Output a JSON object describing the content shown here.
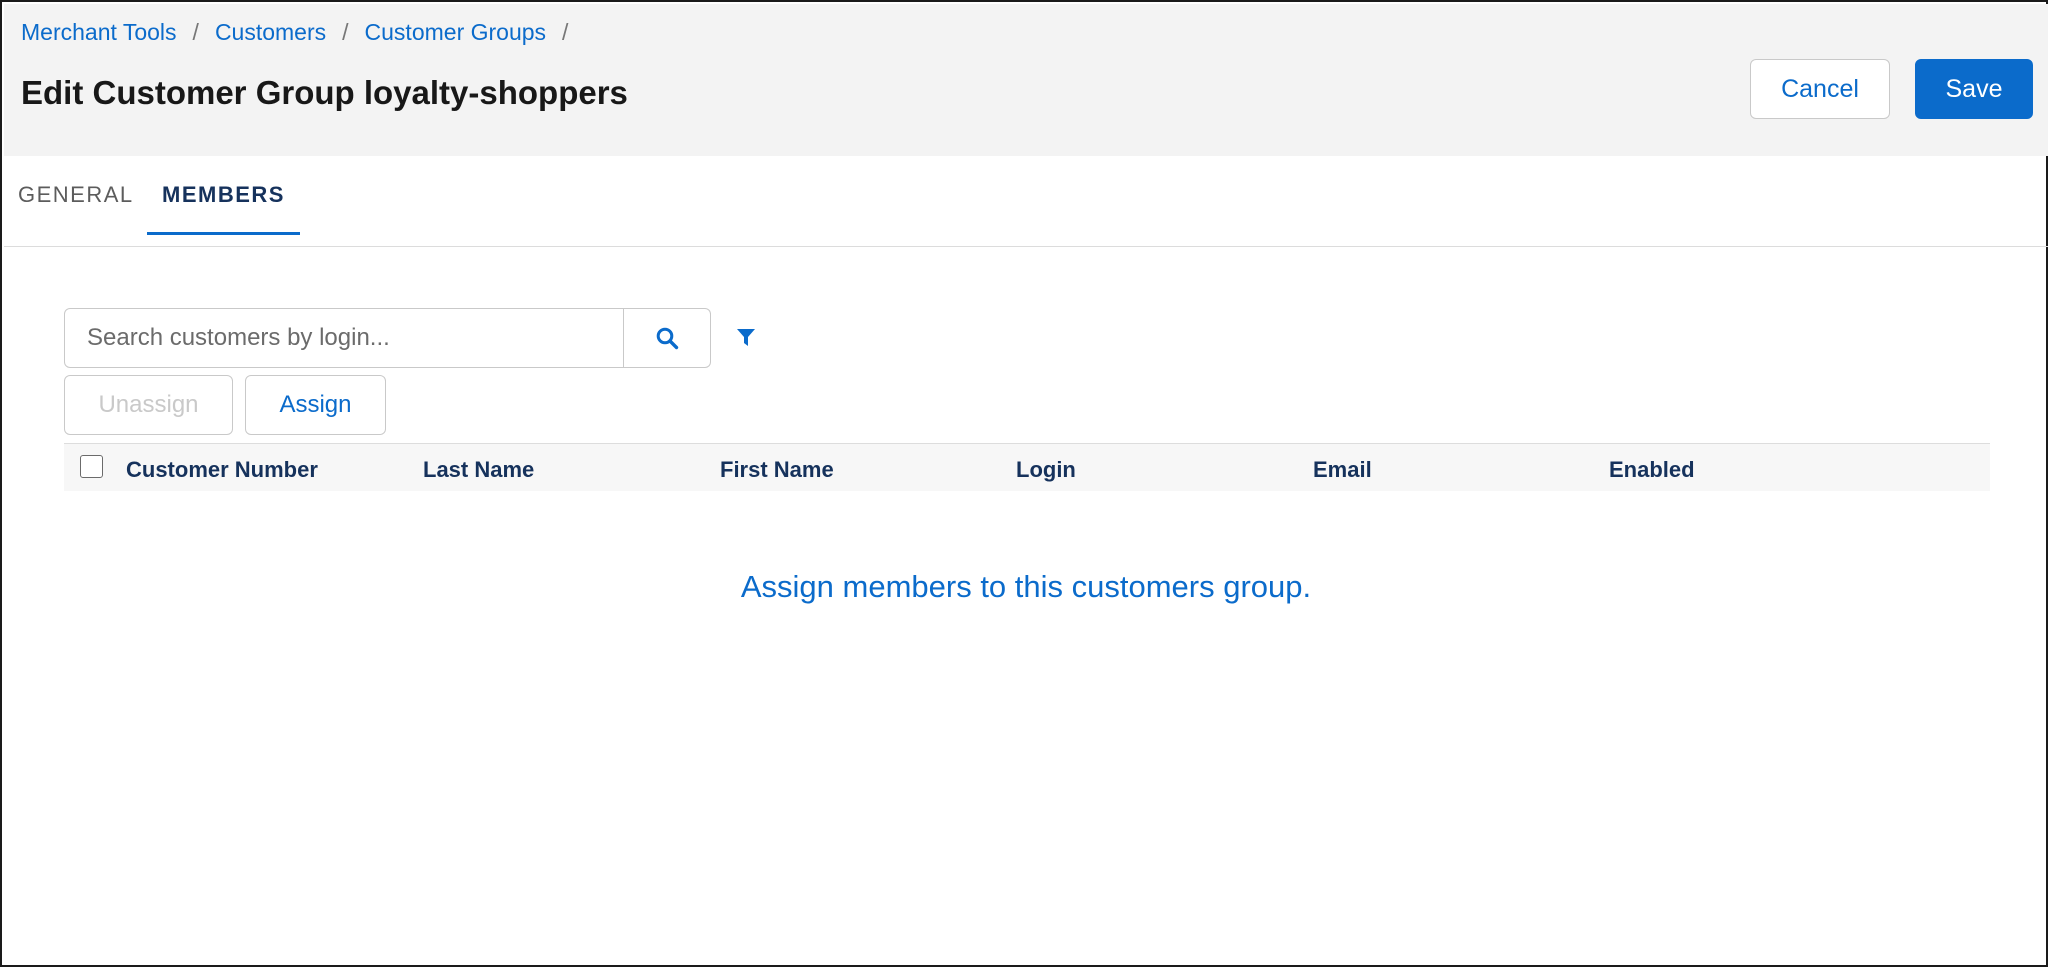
{
  "breadcrumb": [
    {
      "label": "Merchant Tools"
    },
    {
      "label": "Customers"
    },
    {
      "label": "Customer Groups"
    }
  ],
  "breadcrumb_separator": "/",
  "page": {
    "title": "Edit Customer Group loyalty-shoppers"
  },
  "actions": {
    "cancel_label": "Cancel",
    "save_label": "Save"
  },
  "tabs": [
    {
      "label": "GENERAL",
      "active": false
    },
    {
      "label": "MEMBERS",
      "active": true
    }
  ],
  "search": {
    "placeholder": "Search customers by login...",
    "value": ""
  },
  "icons": {
    "search": "search-icon",
    "filter": "filter-icon"
  },
  "buttons": {
    "unassign_label": "Unassign",
    "unassign_disabled": true,
    "assign_label": "Assign"
  },
  "table": {
    "columns": [
      "Customer Number",
      "Last Name",
      "First Name",
      "Login",
      "Email",
      "Enabled"
    ],
    "rows": [],
    "empty_message": "Assign members to this customers group."
  },
  "colors": {
    "accent": "#0b6bcb",
    "header_bg": "#f3f3f3",
    "heading_text": "#16325c"
  }
}
